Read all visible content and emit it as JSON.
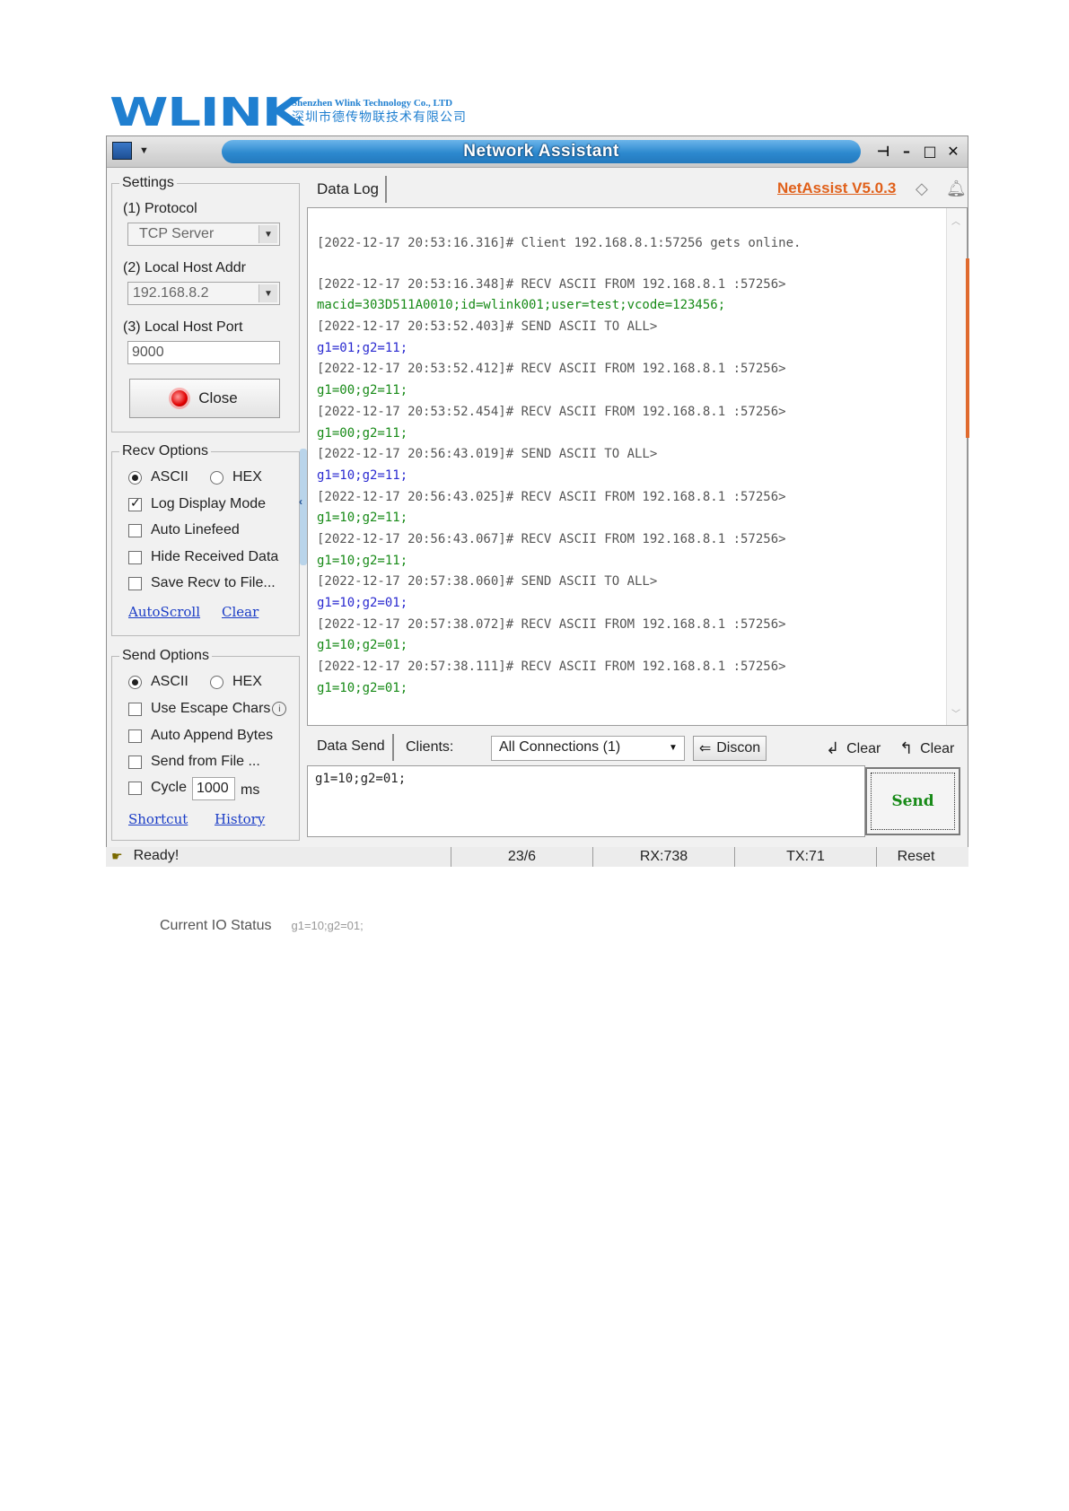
{
  "header": {
    "logo": "WLINK",
    "company_en": "Shenzhen Wlink Technology Co., LTD",
    "company_cn": "深圳市德传物联技术有限公司"
  },
  "window": {
    "title": "Network Assistant",
    "pin_glyph": "⊣",
    "minimize_glyph": "–",
    "maximize_glyph": "□",
    "close_glyph": "✕"
  },
  "settings": {
    "group_title": "Settings",
    "protocol_label": "(1) Protocol",
    "protocol_value": "TCP Server",
    "host_addr_label": "(2) Local Host Addr",
    "host_addr_value": "192.168.8.2",
    "host_port_label": "(3) Local Host Port",
    "host_port_value": "9000",
    "close_button": "Close"
  },
  "recv_options": {
    "group_title": "Recv Options",
    "ascii": "ASCII",
    "hex": "HEX",
    "log_display_mode": "Log Display Mode",
    "auto_linefeed": "Auto Linefeed",
    "hide_received": "Hide Received Data",
    "save_to_file": "Save Recv to File...",
    "autoscroll": "AutoScroll",
    "clear": "Clear"
  },
  "send_options": {
    "group_title": "Send Options",
    "ascii": "ASCII",
    "hex": "HEX",
    "escape_chars": "Use Escape Chars",
    "append_bytes": "Auto Append Bytes",
    "send_from_file": "Send from File ...",
    "cycle": "Cycle",
    "cycle_value": "1000",
    "cycle_unit": "ms",
    "shortcut": "Shortcut",
    "history": "History"
  },
  "data_log": {
    "tab": "Data Log",
    "version_link": "NetAssist V5.0.3",
    "lines": [
      {
        "text": "[2022-12-17 20:53:16.316]# Client 192.168.8.1:57256 gets online.",
        "kind": "hdr"
      },
      {
        "text": "",
        "kind": "gap"
      },
      {
        "text": "[2022-12-17 20:53:16.348]# RECV ASCII FROM 192.168.8.1 :57256>",
        "kind": "hdr"
      },
      {
        "text": "macid=303D511A0010;id=wlink001;user=test;vcode=123456;",
        "kind": "green"
      },
      {
        "text": "[2022-12-17 20:53:52.403]# SEND ASCII TO ALL>",
        "kind": "hdr"
      },
      {
        "text": "g1=01;g2=11;",
        "kind": "blue"
      },
      {
        "text": "[2022-12-17 20:53:52.412]# RECV ASCII FROM 192.168.8.1 :57256>",
        "kind": "hdr"
      },
      {
        "text": "g1=00;g2=11;",
        "kind": "green"
      },
      {
        "text": "[2022-12-17 20:53:52.454]# RECV ASCII FROM 192.168.8.1 :57256>",
        "kind": "hdr"
      },
      {
        "text": "g1=00;g2=11;",
        "kind": "green"
      },
      {
        "text": "[2022-12-17 20:56:43.019]# SEND ASCII TO ALL>",
        "kind": "hdr"
      },
      {
        "text": "g1=10;g2=11;",
        "kind": "blue"
      },
      {
        "text": "[2022-12-17 20:56:43.025]# RECV ASCII FROM 192.168.8.1 :57256>",
        "kind": "hdr"
      },
      {
        "text": "g1=10;g2=11;",
        "kind": "green"
      },
      {
        "text": "[2022-12-17 20:56:43.067]# RECV ASCII FROM 192.168.8.1 :57256>",
        "kind": "hdr"
      },
      {
        "text": "g1=10;g2=11;",
        "kind": "green"
      },
      {
        "text": "[2022-12-17 20:57:38.060]# SEND ASCII TO ALL>",
        "kind": "hdr"
      },
      {
        "text": "g1=10;g2=01;",
        "kind": "blue"
      },
      {
        "text": "[2022-12-17 20:57:38.072]# RECV ASCII FROM 192.168.8.1 :57256>",
        "kind": "hdr"
      },
      {
        "text": "g1=10;g2=01;",
        "kind": "green"
      },
      {
        "text": "[2022-12-17 20:57:38.111]# RECV ASCII FROM 192.168.8.1 :57256>",
        "kind": "hdr"
      },
      {
        "text": "g1=10;g2=01;",
        "kind": "green"
      }
    ]
  },
  "data_send": {
    "tab": "Data Send",
    "clients_label": "Clients:",
    "clients_value": "All Connections (1)",
    "discon": "Discon",
    "clear1": "Clear",
    "clear2": "Clear",
    "input_value": "g1=10;g2=01;",
    "send": "Send"
  },
  "status": {
    "ready": "Ready!",
    "counter": "23/6",
    "rx": "RX:738",
    "tx": "TX:71",
    "reset": "Reset"
  },
  "io_status": {
    "label": "Current IO Status",
    "value": "g1=10;g2=01;"
  }
}
